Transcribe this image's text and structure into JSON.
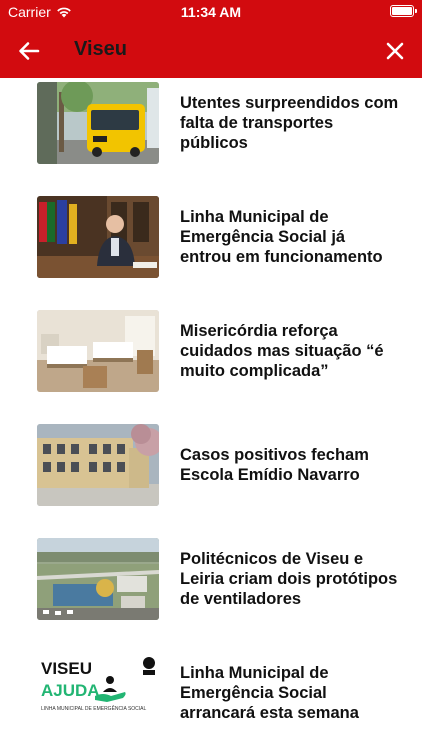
{
  "status_bar": {
    "carrier": "Carrier",
    "time": "11:34 AM"
  },
  "nav": {
    "title": "Viseu"
  },
  "articles": [
    {
      "title": "Utentes surpreendidos com falta de transportes públicos"
    },
    {
      "title": "Linha Municipal de Emergência Social já entrou em funcionamento"
    },
    {
      "title": "Misericórdia reforça cuidados mas situação “é muito complicada”"
    },
    {
      "title": "Casos positivos fecham Escola Emídio Navarro"
    },
    {
      "title": "Politécnicos de Viseu e Leiria criam dois protótipos de ventiladores"
    },
    {
      "title": "Linha Municipal de Emergência  Social arrancará esta semana"
    }
  ],
  "thumb_logo": {
    "line1": "VISEU",
    "line2": "AJUDA",
    "tagline": "LINHA MUNICIPAL DE EMERGÊNCIA SOCIAL"
  },
  "colors": {
    "header": "#d20b0f",
    "logo_green": "#22b573"
  }
}
